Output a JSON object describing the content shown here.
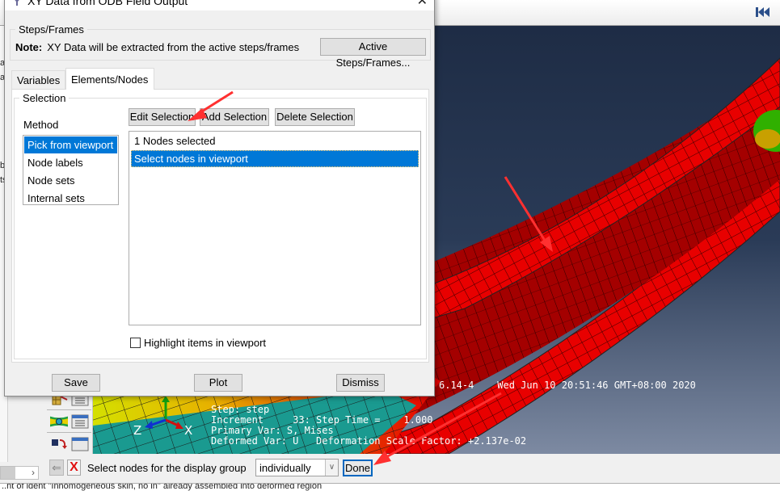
{
  "dialog": {
    "title": "XY Data from ODB Field Output",
    "close_glyph": "✕",
    "steps_frames": {
      "group_label": "Steps/Frames",
      "note_label": "Note:",
      "note_text": "XY Data will be extracted from the active steps/frames",
      "active_button": "Active Steps/Frames..."
    },
    "tabs": [
      {
        "label": "Variables",
        "active": false
      },
      {
        "label": "Elements/Nodes",
        "active": true
      }
    ],
    "selection": {
      "group_label": "Selection",
      "method_label": "Method",
      "methods": [
        {
          "label": "Pick from viewport",
          "selected": true
        },
        {
          "label": "Node labels",
          "selected": false
        },
        {
          "label": "Node sets",
          "selected": false
        },
        {
          "label": "Internal sets",
          "selected": false
        }
      ],
      "buttons": {
        "edit": "Edit Selection",
        "add": "Add Selection",
        "delete": "Delete Selection"
      },
      "list_rows": [
        {
          "text": "1 Nodes selected",
          "selected": false
        },
        {
          "text": "Select nodes in viewport",
          "selected": true
        }
      ],
      "highlight_label": "Highlight items in viewport",
      "highlight_checked": false
    },
    "footer": {
      "save": "Save",
      "plot": "Plot",
      "dismiss": "Dismiss"
    }
  },
  "viewport": {
    "version_date": "6.14-4    Wed Jun 10 20:51:46 GMT+08:00 2020",
    "legend_lines": [
      "Step: step",
      "Increment     33: Step Time =    1.000",
      "Primary Var: S, Mises",
      "Deformed Var: U   Deformation Scale Factor: +2.137e-02"
    ],
    "triad": {
      "x": "X",
      "z": "Z"
    }
  },
  "left_strip_fragments": [
    "a",
    "a:",
    "b:",
    "ts"
  ],
  "prompt": {
    "text": "Select nodes for the display group",
    "mode_value": "individually",
    "done": "Done",
    "back_glyph": "⇐",
    "cancel_glyph": "X"
  },
  "message_area": {
    "text": "..nt of ident \"Inhomogeneous skin, no in\" already assembled into deformed region"
  },
  "colors": {
    "selection_blue": "#0078d7",
    "mesh_red": "#e80000",
    "annotation_red": "#ff3030",
    "viewport_top": "#1e2c45",
    "viewport_bottom": "#7d8aa2"
  }
}
